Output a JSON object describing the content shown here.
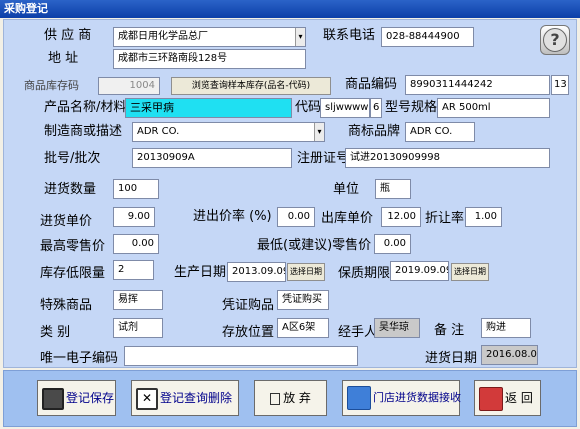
{
  "window": {
    "title": "采购登记"
  },
  "supplier": {
    "label": "供 应 商",
    "value": "成都日用化学品总厂",
    "phone_label": "联系电话",
    "phone": "028-88444900"
  },
  "address": {
    "label": "地  址",
    "value": "成都市三环路南段128号"
  },
  "stock": {
    "label": "商品库存码",
    "value": "1004",
    "browse_button": "浏览查询样本库存(品名-代码)"
  },
  "barcode": {
    "label": "商品编码",
    "value": "8990311444242",
    "count": "13"
  },
  "product": {
    "label": "产品名称/材料",
    "value": "三采甲病",
    "code_label": "代码",
    "code": "sljwwww",
    "code_len": "6",
    "model_label": "型号规格",
    "model": "AR    500ml"
  },
  "maker": {
    "label": "制造商或描述",
    "value": "ADR CO.",
    "brand_label": "商标品牌",
    "brand": "ADR CO."
  },
  "batch": {
    "label": "批号/批次",
    "value": "20130909A",
    "reg_label": "注册证号",
    "reg": "试进20130909998"
  },
  "qty": {
    "label": "进货数量",
    "value": "100",
    "unit_label": "单位",
    "unit": "瓶"
  },
  "price": {
    "label": "进货单价",
    "value": "9.00",
    "diff_label": "进出价率 (%)",
    "diff": "0.00",
    "out_label": "出库单价",
    "out": "12.00",
    "discount_label": "折让率",
    "discount": "1.00"
  },
  "retail": {
    "max_label": "最高零售价",
    "max": "0.00",
    "min_label": "最低(或建议)零售价",
    "min": "0.00"
  },
  "limit": {
    "label": "库存低限量",
    "value": "2",
    "prod_label": "生产日期",
    "prod": "2013.09.09",
    "prod_btn": "选择日期",
    "exp_label": "保质期限",
    "exp": "2019.09.09",
    "exp_btn": "选择日期"
  },
  "special": {
    "label": "特殊商品",
    "value": "易挥",
    "voucher_label": "凭证购品",
    "voucher": "凭证购买"
  },
  "category": {
    "label": "类  别",
    "value": "试剂",
    "location_label": "存放位置",
    "location": "A区6架",
    "handler_label": "经手人",
    "handler": "吴华琼",
    "remark_label": "备  注",
    "remark": "购进"
  },
  "ecode": {
    "label": "唯一电子编码",
    "value": "",
    "date_label": "进货日期",
    "date": "2016.08.04"
  },
  "buttons": {
    "save": "登记保存",
    "delete": "登记查询删除",
    "cancel": "放 弃",
    "receive": "门店进货数据接收",
    "back": "返 回"
  },
  "colors": {
    "title_bar": "#0c3fa8",
    "panel": "#c5d7f6",
    "highlight": "#1fe0f2"
  }
}
